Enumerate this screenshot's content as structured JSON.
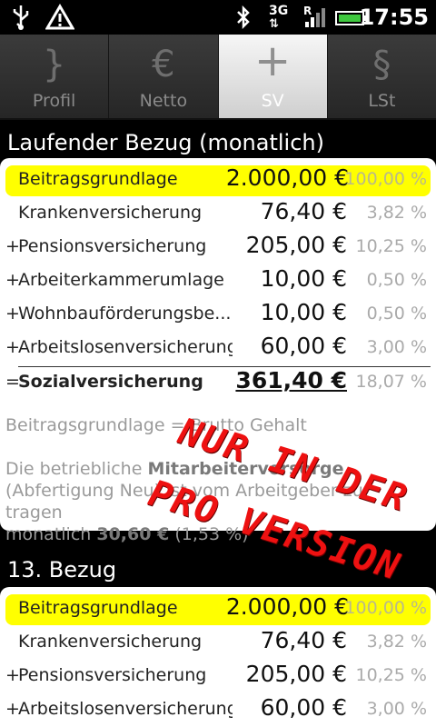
{
  "statusbar": {
    "time": "17:55",
    "icons": [
      "usb-icon",
      "warning-icon",
      "bluetooth-icon",
      "3g-icon",
      "signal-icon",
      "battery-icon"
    ],
    "network_label": "3G",
    "roaming_label": "R"
  },
  "tabs": [
    {
      "label": "Profil",
      "icon": "profile-icon",
      "glyph": "}",
      "active": false
    },
    {
      "label": "Netto",
      "icon": "euro-icon",
      "glyph": "€",
      "active": false
    },
    {
      "label": "SV",
      "icon": "plus-icon",
      "glyph": "+",
      "active": true
    },
    {
      "label": "LSt",
      "icon": "paragraph-icon",
      "glyph": "§",
      "active": false
    }
  ],
  "section1": {
    "title": "Laufender Bezug (monatlich)",
    "rows": [
      {
        "op": "",
        "label": "Beitragsgrundlage",
        "amount": "2.000,00 €",
        "percent": "100,00 %"
      },
      {
        "op": "",
        "label": "Krankenversicherung",
        "amount": "76,40 €",
        "percent": "3,82 %"
      },
      {
        "op": "+",
        "label": "Pensionsversicherung",
        "amount": "205,00 €",
        "percent": "10,25 %"
      },
      {
        "op": "+",
        "label": "Arbeiterkammerumlage",
        "amount": "10,00 €",
        "percent": "0,50 %"
      },
      {
        "op": "+",
        "label": "Wohnbauförderungsbe...",
        "amount": "10,00 €",
        "percent": "0,50 %"
      },
      {
        "op": "+",
        "label": "Arbeitslosenversicherung",
        "amount": "60,00 €",
        "percent": "3,00 %"
      },
      {
        "op": "=",
        "label": "Sozialversicherung",
        "amount": "361,40 €",
        "percent": "18,07 %"
      }
    ],
    "note1": "Beitragsgrundlage = Brutto Gehalt",
    "note2_prefix": "Die betriebliche ",
    "note2_bold": "Mitarbeitervorsorge",
    "note2_line2": "(Abfertigung Neu) ist vom Arbeitgeber zu tragen",
    "note2_line3_prefix": "monatlich ",
    "note2_line3_bold": "30,60 €",
    "note2_line3_suffix": " (1,53 %)"
  },
  "section2": {
    "title": "13. Bezug",
    "rows": [
      {
        "op": "",
        "label": "Beitragsgrundlage",
        "amount": "2.000,00 €",
        "percent": "100,00 %"
      },
      {
        "op": "",
        "label": "Krankenversicherung",
        "amount": "76,40 €",
        "percent": "3,82 %"
      },
      {
        "op": "+",
        "label": "Pensionsversicherung",
        "amount": "205,00 €",
        "percent": "10,25 %"
      },
      {
        "op": "+",
        "label": "Arbeitslosenversicherung",
        "amount": "60,00 €",
        "percent": "3,00 %"
      }
    ]
  },
  "stamp": {
    "line1": "NUR IN DER",
    "line2": "PRO VERSION",
    "color": "#ee1111"
  },
  "colors": {
    "highlight": "#ffff00",
    "background": "#000000",
    "panel": "#ffffff"
  }
}
